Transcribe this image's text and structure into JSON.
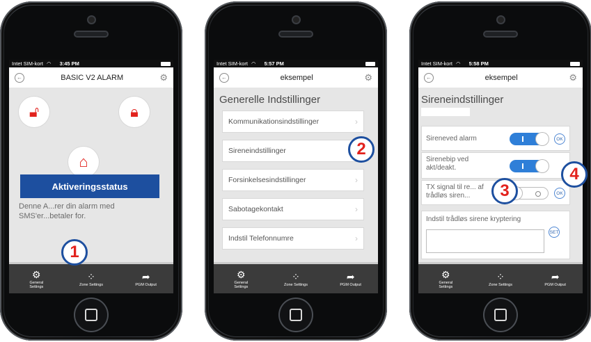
{
  "screens": [
    {
      "status": {
        "carrier": "Intet SIM-kort",
        "time": "3:45 PM"
      },
      "title": "BASIC V2 ALARM",
      "action_button": "Aktiveringsstatus",
      "description": "Denne A...rer din alarm med SMS'er...betaler for."
    },
    {
      "status": {
        "carrier": "Intet SIM-kort",
        "time": "5:57 PM"
      },
      "title": "eksempel",
      "heading": "Generelle Indstillinger",
      "menu": [
        {
          "label": "Kommunikationsindstillinger"
        },
        {
          "label": "Sireneindstillinger"
        },
        {
          "label": "Forsinkelsesindstillinger"
        },
        {
          "label": "Sabotagekontakt"
        },
        {
          "label": "Indstil Telefonnumre"
        }
      ]
    },
    {
      "status": {
        "carrier": "Intet SIM-kort",
        "time": "5:58 PM"
      },
      "title": "eksempel",
      "heading": "Sireneindstillinger",
      "rows": [
        {
          "label": "Sireneved alarm",
          "state": "on",
          "button": "OK"
        },
        {
          "label": "Sirenebip ved akt/deakt.",
          "state": "on",
          "button": "OK"
        },
        {
          "label": "TX signal til re... af trådløs siren...",
          "state": "off",
          "button": "OK"
        }
      ],
      "encryption": {
        "label": "Indstil trådløs sirene kryptering",
        "button": "SET",
        "value": ""
      }
    }
  ],
  "tabbar": [
    {
      "icon": "gear-icon",
      "label": "General Settings"
    },
    {
      "icon": "grid-dots-icon",
      "label": "Zone Settings"
    },
    {
      "icon": "share-arrow-icon",
      "label": "PGM Output"
    }
  ],
  "callouts": [
    "1",
    "2",
    "3",
    "4"
  ]
}
